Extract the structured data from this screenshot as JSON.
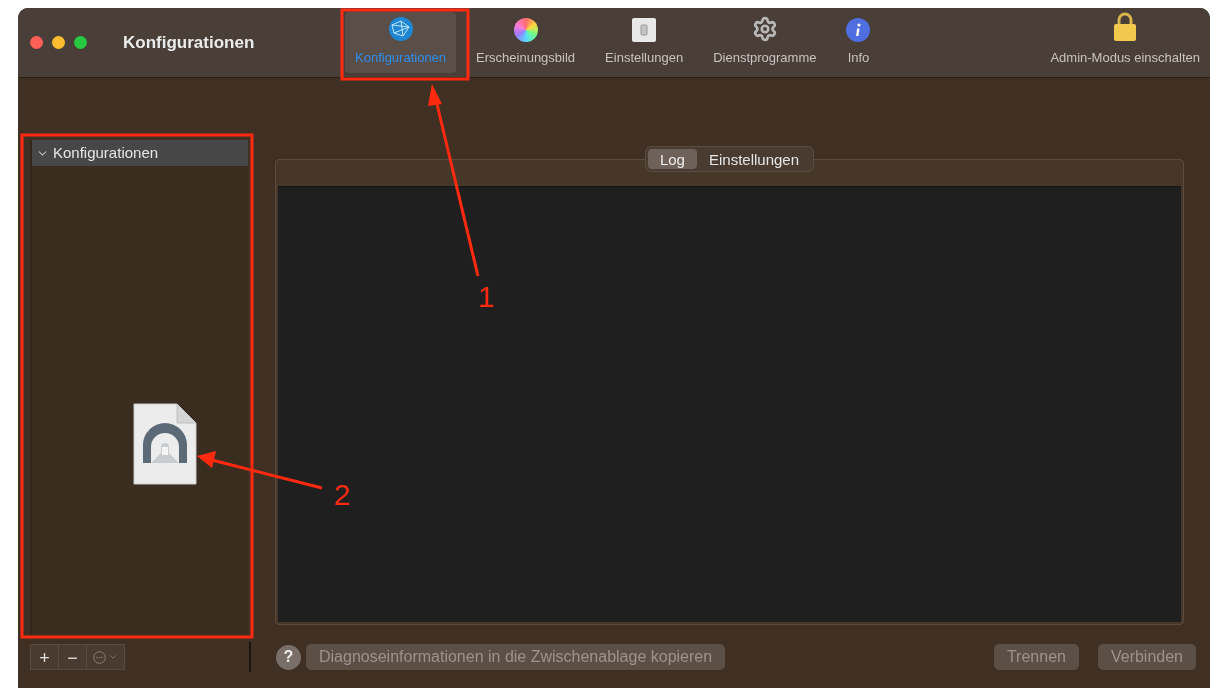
{
  "window": {
    "title": "Konfigurationen"
  },
  "toolbar": [
    {
      "label": "Konfigurationen",
      "kind": "globe",
      "selected": true
    },
    {
      "label": "Erscheinungsbild",
      "kind": "colors",
      "selected": false
    },
    {
      "label": "Einstellungen",
      "kind": "switch",
      "selected": false
    },
    {
      "label": "Dienstprogramme",
      "kind": "gear",
      "selected": false
    },
    {
      "label": "Info",
      "kind": "info",
      "selected": false
    }
  ],
  "admin_button": {
    "label": "Admin-Modus einschalten"
  },
  "sidebar": {
    "header": {
      "label": "Konfigurationen",
      "expanded": true
    },
    "add": "+",
    "remove": "−"
  },
  "tabs": [
    {
      "label": "Log",
      "selected": true
    },
    {
      "label": "Einstellungen",
      "selected": false
    }
  ],
  "bottom_bar": {
    "help": "?",
    "buttons": [
      {
        "label": "Diagnoseinformationen in die Zwischenablage kopieren",
        "disabled": true
      },
      {
        "label": "Trennen",
        "disabled": true
      },
      {
        "label": "Verbinden",
        "disabled": true
      }
    ]
  },
  "annotations": [
    {
      "label": "1"
    },
    {
      "label": "2"
    }
  ]
}
